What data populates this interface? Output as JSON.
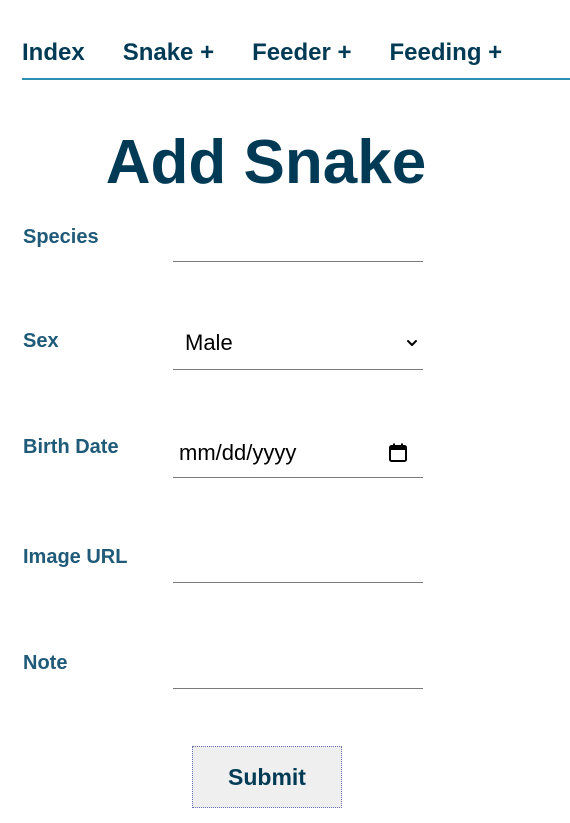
{
  "nav": {
    "items": [
      {
        "label": "Index"
      },
      {
        "label": "Snake +"
      },
      {
        "label": "Feeder +"
      },
      {
        "label": "Feeding +"
      }
    ]
  },
  "page_title": "Add Snake",
  "form": {
    "species": {
      "label": "Species",
      "value": ""
    },
    "sex": {
      "label": "Sex",
      "selected": "Male"
    },
    "birth_date": {
      "label": "Birth Date",
      "placeholder": "mm/dd/yyyy"
    },
    "image_url": {
      "label": "Image URL",
      "value": ""
    },
    "note": {
      "label": "Note",
      "value": ""
    },
    "submit_label": "Submit"
  },
  "icons": {
    "sex_dropdown": "chevron-down-icon",
    "birth_date_picker": "calendar-icon"
  },
  "colors": {
    "heading": "#003a55",
    "label": "#1f5a78",
    "nav_underline": "#2a8fb0",
    "field_underline": "#7a7a7a",
    "button_bg": "#efefef"
  }
}
